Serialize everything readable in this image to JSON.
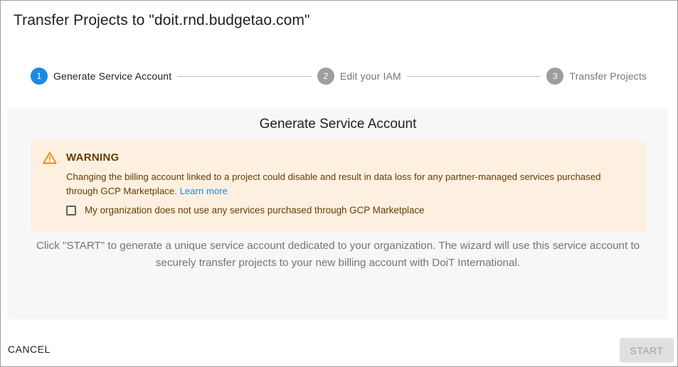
{
  "dialog": {
    "title": "Transfer Projects to \"doit.rnd.budgetao.com\""
  },
  "stepper": {
    "steps": [
      {
        "number": "1",
        "label": "Generate Service Account",
        "state": "active"
      },
      {
        "number": "2",
        "label": "Edit your IAM",
        "state": "inactive"
      },
      {
        "number": "3",
        "label": "Transfer Projects",
        "state": "inactive"
      }
    ]
  },
  "panel": {
    "title": "Generate Service Account",
    "warning": {
      "icon": "warning-triangle-icon",
      "title": "WARNING",
      "text": "Changing the billing account linked to a project could disable and result in data loss for any partner-managed services purchased through GCP Marketplace.",
      "link_label": "Learn more",
      "checkbox_label": "My organization does not use any services purchased through GCP Marketplace",
      "checkbox_checked": false
    },
    "description": "Click \"START\" to generate a unique service account dedicated to your organization. The wizard will use this service account to securely transfer projects to your new billing account with DoiT International."
  },
  "footer": {
    "cancel_label": "CANCEL",
    "start_label": "START"
  },
  "colors": {
    "accent": "#1e88e5",
    "warning_bg": "#fdf0e1",
    "warning_text": "#663c00",
    "warning_icon": "#f57c00"
  }
}
